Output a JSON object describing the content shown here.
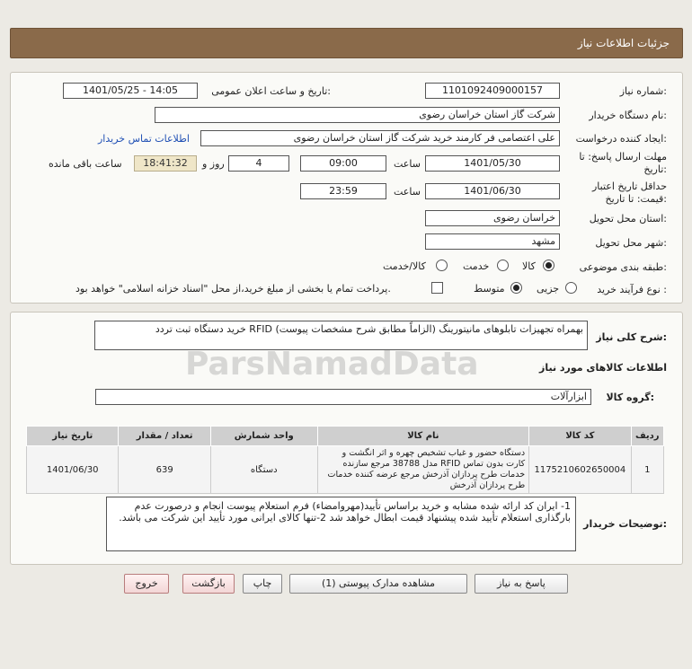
{
  "header": {
    "title": "جزئیات اطلاعات نیاز"
  },
  "form": {
    "need_number_label": "شماره نیاز:",
    "need_number": "1101092409000157",
    "announce_label": "تاریخ و ساعت اعلان عمومی:",
    "announce_value": "1401/05/25 - 14:05",
    "buyer_org_label": "نام دستگاه خریدار:",
    "buyer_org": "شرکت گاز استان خراسان رضوی",
    "creator_label": "ایجاد کننده درخواست:",
    "creator": "علی اعتصامی فر کارمند خرید شرکت گاز استان خراسان رضوی",
    "contact_link": "اطلاعات تماس خریدار",
    "reply_deadline_label_1": "مهلت ارسال پاسخ: تا",
    "reply_deadline_label_2": "تاریخ:",
    "reply_date": "1401/05/30",
    "time_label": "ساعت",
    "reply_time": "09:00",
    "days": "4",
    "days_label": "روز و",
    "remain_time": "18:41:32",
    "remain_label": "ساعت باقی مانده",
    "validity_label_1": "حداقل تاریخ اعتبار",
    "validity_label_2": "قیمت: تا تاریخ:",
    "validity_date": "1401/06/30",
    "validity_time_label": "ساعت",
    "validity_time": "23:59",
    "province_label": "استان محل تحویل:",
    "province": "خراسان رضوی",
    "city_label": "شهر محل تحویل:",
    "city": "مشهد",
    "category_label": "طبقه بندی موضوعی:",
    "category_options": [
      "کالا",
      "خدمت",
      "کالا/خدمت"
    ],
    "process_label": "نوع فرآیند خرید :",
    "process_options": [
      "جزیی",
      "متوسط"
    ],
    "treasury_note": "پرداخت تمام یا بخشی از مبلغ خرید،از محل \"اسناد خزانه اسلامی\" خواهد بود."
  },
  "description": {
    "label": "شرح کلی نیاز:",
    "text": "خرید دستگاه ثبت تردد RFID بهمراه تجهیزات تابلوهای مانیتورینگ (الزاماً مطابق شرح مشخصات پیوست)"
  },
  "goods": {
    "section_title": "اطلاعات کالاهای مورد نیاز",
    "group_label": "گروه کالا:",
    "group_value": "ابزارآلات",
    "columns": [
      "ردیف",
      "کد کالا",
      "نام کالا",
      "واحد شمارش",
      "تعداد / مقدار",
      "تاریخ نیاز"
    ],
    "rows": [
      {
        "index": "1",
        "code": "1175210602650004",
        "name": "دستگاه حضور و غیاب تشخیص چهره و اثر انگشت و کارت بدون تماس RFID مدل 38788 مرجع سازنده خدمات طرح پردازان آذرخش مرجع عرضه کننده خدمات طرح پردازان آذرخش",
        "unit": "دستگاه",
        "qty": "639",
        "date": "1401/06/30"
      }
    ]
  },
  "notes": {
    "label": "توضیحات خریدار:",
    "text": "1- ایران کد ارائه شده مشابه و خرید براساس تأیید(مهروامضاء) فرم استعلام پیوست انجام و درصورت عدم بارگذاری استعلام تأیید شده پیشنهاد قیمت ابطال خواهد شد 2-تنها کالای ایرانی مورد تأیید این شرکت می باشد."
  },
  "buttons": {
    "reply": "پاسخ به نیاز",
    "attachments": "مشاهده مدارک پیوستی (1)",
    "print": "چاپ",
    "back": "بازگشت",
    "exit": "خروج"
  },
  "watermark": {
    "brand": "ParsNamadData"
  }
}
